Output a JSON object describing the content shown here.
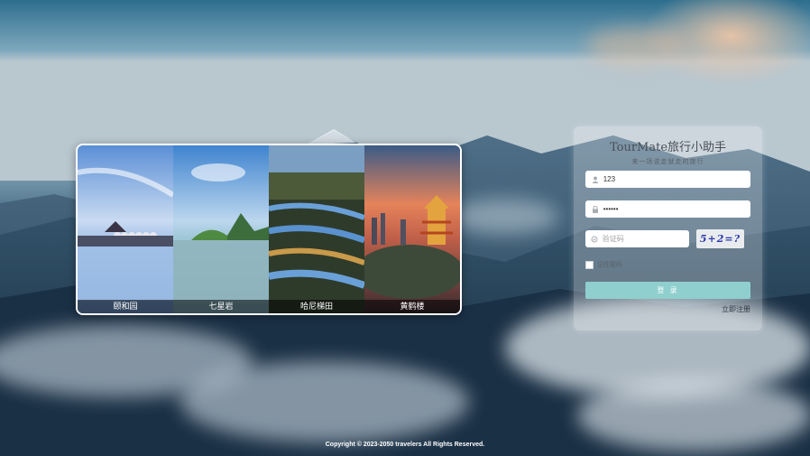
{
  "footer": {
    "copyright": "Copyright © 2023-2050 travelers All Rights Reserved."
  },
  "gallery": {
    "items": [
      {
        "label": "颐和园",
        "icon": "summer-palace-photo"
      },
      {
        "label": "七星岩",
        "icon": "seven-star-crags-photo"
      },
      {
        "label": "哈尼梯田",
        "icon": "hani-terraces-photo"
      },
      {
        "label": "黄鹤楼",
        "icon": "yellow-crane-tower-photo"
      }
    ]
  },
  "login": {
    "title": "TourMate旅行小助手",
    "subtitle": "来一场说走就走的旅行",
    "username": {
      "value": "123",
      "icon": "user-icon"
    },
    "password": {
      "value": "••••••",
      "icon": "lock-icon"
    },
    "captcha": {
      "placeholder": "验证码",
      "image_text": "5+2=?",
      "icon": "shield-icon"
    },
    "remember_label": "记住密码",
    "submit_label": "登 录",
    "register_label": "立即注册",
    "accent_color": "#8fcfce"
  }
}
